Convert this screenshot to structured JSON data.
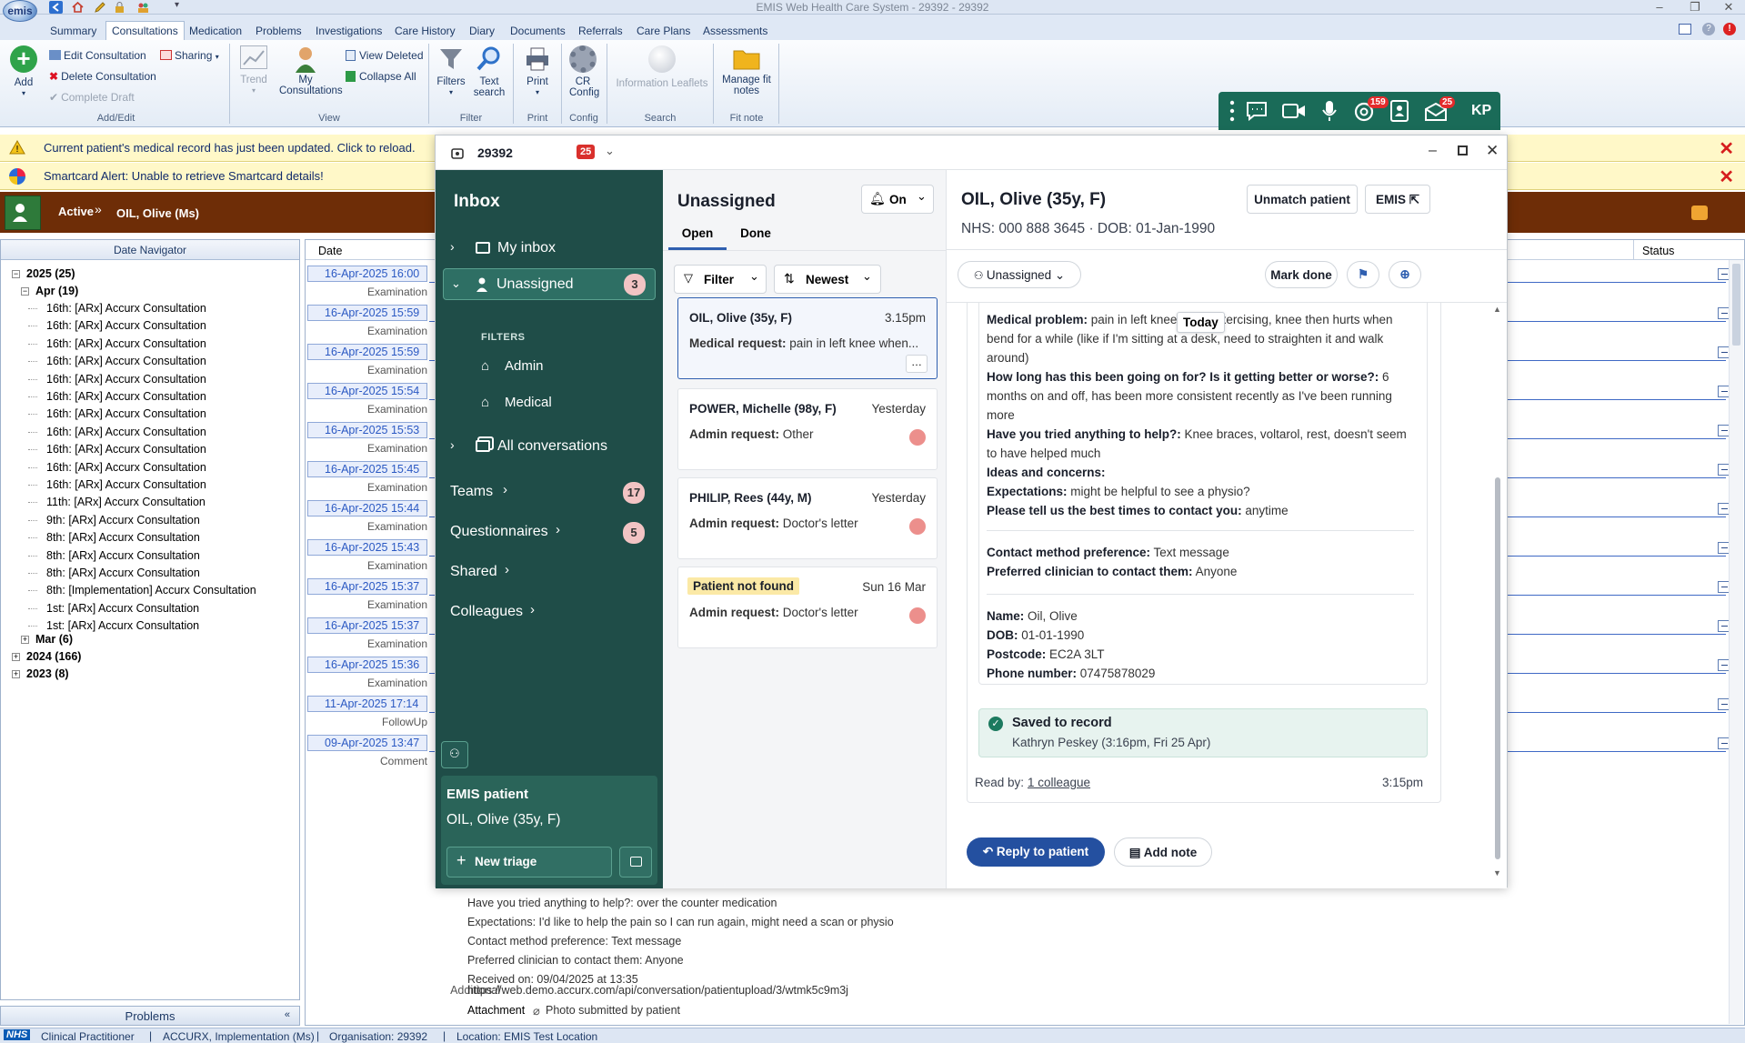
{
  "app": {
    "title": "EMIS Web Health Care System - 29392 - 29392",
    "logo_text": "emis"
  },
  "tabs": [
    "Summary",
    "Consultations",
    "Medication",
    "Problems",
    "Investigations",
    "Care History",
    "Diary",
    "Documents",
    "Referrals",
    "Care Plans",
    "Assessments"
  ],
  "ribbon": {
    "add": "Add",
    "edit_consultation": "Edit Consultation",
    "delete_consultation": "Delete Consultation",
    "complete_draft": "Complete Draft",
    "sharing": "Sharing",
    "group_add_edit": "Add/Edit",
    "trend": "Trend",
    "my_consultations": "My Consultations",
    "view_deleted": "View Deleted",
    "collapse_all": "Collapse All",
    "group_view": "View",
    "filters": "Filters",
    "group_filter": "Filter",
    "text_search": "Text search",
    "print": "Print",
    "group_print": "Print",
    "cr_config": "CR Config",
    "group_config": "Config",
    "information_leaflets": "Information Leaflets",
    "group_search": "Search",
    "manage_fit_notes": "Manage fit notes",
    "group_fit_note": "Fit note"
  },
  "alerts": [
    {
      "text": "Current patient's medical record has just been updated. Click to reload."
    },
    {
      "text": "Smartcard Alert:  Unable to retrieve Smartcard details!"
    }
  ],
  "banner": {
    "status": "Active",
    "patient": "OIL, Olive (Ms)"
  },
  "navigator": {
    "header": "Date Navigator",
    "year_2025": "2025 (25)",
    "apr": "Apr (19)",
    "items": [
      "16th: [ARx] Accurx Consultation",
      "16th: [ARx] Accurx Consultation",
      "16th: [ARx] Accurx Consultation",
      "16th: [ARx] Accurx Consultation",
      "16th: [ARx] Accurx Consultation",
      "16th: [ARx] Accurx Consultation",
      "16th: [ARx] Accurx Consultation",
      "16th: [ARx] Accurx Consultation",
      "16th: [ARx] Accurx Consultation",
      "16th: [ARx] Accurx Consultation",
      "16th: [ARx] Accurx Consultation",
      "11th: [ARx] Accurx Consultation",
      "9th: [ARx] Accurx Consultation",
      "8th: [ARx] Accurx Consultation",
      "8th: [ARx] Accurx Consultation",
      "8th: [ARx] Accurx Consultation",
      "8th: [Implementation] Accurx Consultation",
      "1st: [ARx] Accurx Consultation",
      "1st: [ARx] Accurx Consultation"
    ],
    "mar": "Mar (6)",
    "year_2024": "2024 (166)",
    "year_2023": "2023 (8)"
  },
  "timeline": {
    "col_date": "Date",
    "col_status": "Status",
    "rows": [
      {
        "date": "16-Apr-2025 16:00",
        "type": "Examination"
      },
      {
        "date": "16-Apr-2025 15:59",
        "type": "Examination"
      },
      {
        "date": "16-Apr-2025 15:59",
        "type": "Examination"
      },
      {
        "date": "16-Apr-2025 15:54",
        "type": "Examination"
      },
      {
        "date": "16-Apr-2025 15:53",
        "type": "Examination"
      },
      {
        "date": "16-Apr-2025 15:45",
        "type": "Examination"
      },
      {
        "date": "16-Apr-2025 15:44",
        "type": "Examination"
      },
      {
        "date": "16-Apr-2025 15:43",
        "type": "Examination"
      },
      {
        "date": "16-Apr-2025 15:37",
        "type": "Examination"
      },
      {
        "date": "16-Apr-2025 15:37",
        "type": "Examination"
      },
      {
        "date": "16-Apr-2025 15:36",
        "type": "Examination"
      },
      {
        "date": "11-Apr-2025 17:14",
        "type": "FollowUp"
      },
      {
        "date": "09-Apr-2025 13:47",
        "type": "Comment"
      }
    ],
    "details": [
      "Have you tried anything to help?: over the counter medication",
      "Expectations: I'd like to help the pain so I can run again, might need a scan or physio",
      "Contact method preference: Text message",
      "Preferred clinician to contact them: Anyone",
      "Received on: 09/04/2025 at 13:35"
    ],
    "additional_label": "Additional",
    "link": "https://web.demo.accurx.com/api/conversation/patientupload/3/wtmk5c9m3j",
    "attachment_label": "Attachment",
    "attachment_text": "Photo submitted by patient"
  },
  "problems_bar": "Problems",
  "statusbar": {
    "nhs": "NHS",
    "role": "Clinical Practitioner",
    "user": "ACCURX, Implementation (Ms)",
    "org": "Organisation: 29392",
    "location": "Location:  EMIS Test Location"
  },
  "toolbar": {
    "badge_mentions": "159",
    "badge_inbox": "25",
    "initials": "KP"
  },
  "accurx": {
    "org": "29392",
    "org_badge": "25",
    "sidebar": {
      "title": "Inbox",
      "my_inbox": "My inbox",
      "unassigned": "Unassigned",
      "unassigned_count": "3",
      "filters": "FILTERS",
      "admin": "Admin",
      "medical": "Medical",
      "all_conversations": "All conversations",
      "teams": "Teams",
      "teams_count": "17",
      "questionnaires": "Questionnaires",
      "questionnaires_count": "5",
      "shared": "Shared",
      "colleagues": "Colleagues",
      "emis_patient": "EMIS patient",
      "patient": "OIL, Olive (35y, F)",
      "new_triage": "New triage"
    },
    "list": {
      "title": "Unassigned",
      "notify": "On",
      "tab_open": "Open",
      "tab_done": "Done",
      "filter": "Filter",
      "sort": "Newest",
      "cards": [
        {
          "name": "OIL, Olive (35y, F)",
          "time": "3.15pm",
          "label": "Medical request:",
          "text": "pain in left knee when..."
        },
        {
          "name": "POWER, Michelle (98y, F)",
          "time": "Yesterday",
          "label": "Admin request:",
          "text": "Other"
        },
        {
          "name": "PHILIP, Rees (44y, M)",
          "time": "Yesterday",
          "label": "Admin request:",
          "text": "Doctor's letter"
        },
        {
          "name": "Patient not found",
          "time": "Sun 16 Mar",
          "label": "Admin request:",
          "text": "Doctor's letter"
        }
      ]
    },
    "detail": {
      "patient": "OIL, Olive (35y, F)",
      "nhs": "NHS: 000 888 3645 · DOB: 01-Jan-1990",
      "unmatch": "Unmatch patient",
      "emis": "EMIS",
      "assignee": "Unassigned",
      "mark_done": "Mark done",
      "today": "Today",
      "lines": [
        {
          "label": "Medical problem:",
          "text": " pain in left knee when exercising, knee then hurts when bend for a while (like if I'm sitting at a desk, need to straighten it and walk around)"
        },
        {
          "label": "How long has this been going on for? Is it getting better or worse?:",
          "text": " 6 months on and off, has been more consistent recently as I've been running more"
        },
        {
          "label": "Have you tried anything to help?:",
          "text": " Knee braces, voltarol, rest, doesn't seem to have helped much"
        },
        {
          "label": "Ideas and concerns:",
          "text": ""
        },
        {
          "label": "Expectations:",
          "text": " might be helpful to see a physio?"
        },
        {
          "label": "Please tell us the best times to contact you:",
          "text": " anytime"
        }
      ],
      "lines2": [
        {
          "label": "Contact method preference:",
          "text": " Text message"
        },
        {
          "label": "Preferred clinician to contact them:",
          "text": " Anyone"
        }
      ],
      "lines3": [
        {
          "label": "Name:",
          "text": " Oil, Olive"
        },
        {
          "label": "DOB:",
          "text": " 01-01-1990"
        },
        {
          "label": "Postcode:",
          "text": " EC2A 3LT"
        },
        {
          "label": "Phone number:",
          "text": " 07475878029"
        }
      ],
      "saved_title": "Saved to record",
      "saved_by": "Kathryn Peskey (3:16pm, Fri 25 Apr)",
      "read_by_label": "Read by:",
      "read_by_link": "1 colleague",
      "read_time": "3:15pm",
      "reply": "Reply to patient",
      "add_note": "Add note"
    }
  }
}
